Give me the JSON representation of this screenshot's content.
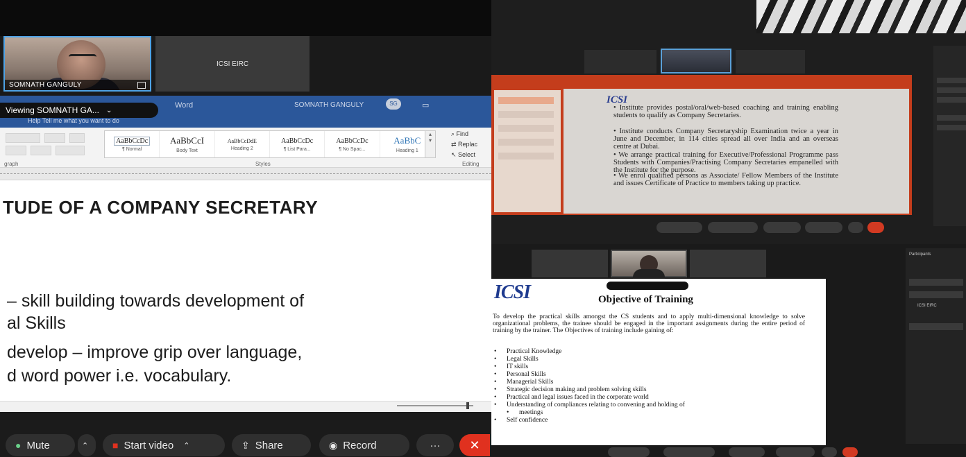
{
  "left": {
    "speaker": {
      "name": "SOMNATH GANGULY"
    },
    "tile2": {
      "name": "ICSI EIRC"
    },
    "word_titlebar": {
      "app": "Word",
      "user": "SOMNATH GANGULY",
      "user_initials": "SG"
    },
    "viewing_pill": "Viewing SOMNATH GA...",
    "tell_me": "Help      Tell me what you want to do",
    "styles": [
      {
        "preview": "AaBbCcDc",
        "name": "¶ Normal"
      },
      {
        "preview": "AaBbCcI",
        "name": "Body Text"
      },
      {
        "preview": "AaBbCcDdE",
        "name": "Heading 2"
      },
      {
        "preview": "AaBbCcDc",
        "name": "¶ List Para..."
      },
      {
        "preview": "AaBbCcDc",
        "name": "¶ No Spac..."
      },
      {
        "preview": "AaBbC",
        "name": "Heading 1"
      }
    ],
    "editing": {
      "find": "Find",
      "replace": "Replac",
      "select": "Select",
      "group": "Editing"
    },
    "groups": {
      "paragraph": "graph",
      "styles": "Styles"
    },
    "doc": {
      "heading": "TUDE OF A COMPANY SECRETARY",
      "line1": "– skill building towards development of",
      "line2": "al Skills",
      "line3": "develop – improve grip over language,",
      "line4": "d word power i.e. vocabulary."
    },
    "controls": {
      "mute": "Mute",
      "video": "Start video",
      "share": "Share",
      "record": "Record",
      "more": "···",
      "end": "✕"
    }
  },
  "right_top": {
    "slide_logo": "ICSI",
    "bullets": [
      "Institute provides postal/oral/web-based coaching and training enabling students to qualify as Company Secretaries.",
      "Institute conducts Company Secretaryship Examination twice a year in June and December, in 114 cities spread all over India and an overseas centre at Dubai.",
      "We arrange practical training for Executive/Professional Programme pass Students with Companies/Practising Company Secretaries empanelled with the Institute for the purpose.",
      "We enrol qualified persons as Associate/ Fellow Members of the Institute and issues Certificate of Practice to members taking up practice."
    ]
  },
  "right_bottom": {
    "logo": "ICSI",
    "heading": "Objective of Training",
    "paragraph": "To develop the practical skills amongst the CS students and to apply multi-dimensional knowledge to solve organizational problems, the trainee should be engaged in the important assignments during the entire period of training by the trainer. The Objectives of training include gaining of:",
    "items": [
      "Practical Knowledge",
      "Legal Skills",
      "IT skills",
      "Personal Skills",
      "Managerial Skills",
      "Strategic decision making and problem solving skills",
      "Practical and legal issues faced in the corporate world",
      "Understanding of compliances relating to convening and holding of",
      "meetings",
      "Self confidence"
    ],
    "participants": {
      "title": "Participants",
      "p1": "ICSI EIRC"
    }
  },
  "colors": {
    "word_blue": "#2b579a",
    "end_red": "#e0311f",
    "zoom_dark": "#1b1b1b"
  }
}
